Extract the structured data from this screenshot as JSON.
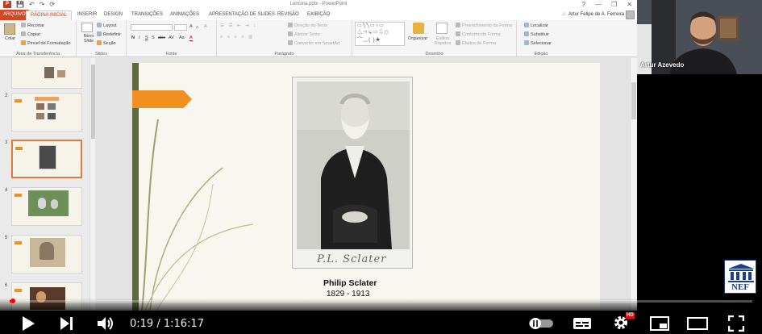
{
  "window": {
    "title": "Lemúria.pptx - PowerPoint",
    "app_badge": "P",
    "help": "?",
    "minimize": "—",
    "restore": "❐",
    "close": "✕"
  },
  "quick_access": [
    "💾",
    "↶",
    "↷",
    "⟳"
  ],
  "tabs": [
    {
      "label": "ARQUIVO",
      "kind": "file"
    },
    {
      "label": "PÁGINA INICIAL",
      "kind": "active"
    },
    {
      "label": "INSERIR"
    },
    {
      "label": "DESIGN"
    },
    {
      "label": "TRANSIÇÕES"
    },
    {
      "label": "ANIMAÇÕES"
    },
    {
      "label": "APRESENTAÇÃO DE SLIDES"
    },
    {
      "label": "REVISÃO"
    },
    {
      "label": "EXIBIÇÃO"
    }
  ],
  "user": {
    "name": "Artur Felipe de A. Ferreira",
    "warn": "⚠"
  },
  "ribbon": {
    "clipboard": {
      "paste": "Colar",
      "cut": "Recortar",
      "copy": "Copiar",
      "format_painter": "Pincel de Formatação",
      "group": "Área de Transferência"
    },
    "slides": {
      "new_slide": "Novo Slide",
      "layout": "Layout",
      "reset": "Redefinir",
      "section": "Seção",
      "group": "Slides"
    },
    "font": {
      "bold": "N",
      "italic": "I",
      "underline": "S",
      "shadow": "S",
      "strike": "abc",
      "spacing": "AV",
      "case": "Aa",
      "grow": "A",
      "shrink": "A",
      "clear": "A",
      "color": "A",
      "group": "Fonte"
    },
    "paragraph": {
      "direction": "Direção do Texto",
      "align": "Alinhar Texto",
      "smartart": "Converter em SmartArt",
      "group": "Parágrafo"
    },
    "drawing": {
      "shapes_row1": "▭╲╲▭○▭",
      "shapes_row2": "△ㄱ↳⇨⇩⬡",
      "shapes_row3": "⌒﹏{ }★",
      "arrange": "Organizar",
      "quick_styles": "Estilos Rápidos",
      "fill": "Preenchimento da Forma",
      "outline": "Contorno da Forma",
      "effects": "Efeitos de Forma",
      "group": "Desenho"
    },
    "editing": {
      "find": "Localizar",
      "replace": "Substituir",
      "select": "Selecionar",
      "group": "Edição"
    }
  },
  "thumbnails": [
    {
      "number": "",
      "selected": false
    },
    {
      "number": "2",
      "selected": false
    },
    {
      "number": "3",
      "selected": true
    },
    {
      "number": "4",
      "selected": false
    },
    {
      "number": "5",
      "selected": false
    },
    {
      "number": "6",
      "selected": false
    }
  ],
  "slide": {
    "caption_name": "Philip Sclater",
    "caption_years": "1829 - 1913",
    "signature": "P.L. Sclater"
  },
  "webcam": {
    "name": "Artur Azevedo"
  },
  "watermark": {
    "text": "NEF"
  },
  "player": {
    "current_time": "0:19",
    "separator": " / ",
    "duration": "1:16:17",
    "progress": 0.0042,
    "hd_badge": "HD",
    "play_icon": "▶",
    "next_icon": "⏭",
    "volume_icon": "🔊",
    "accent": "#ff0000"
  }
}
